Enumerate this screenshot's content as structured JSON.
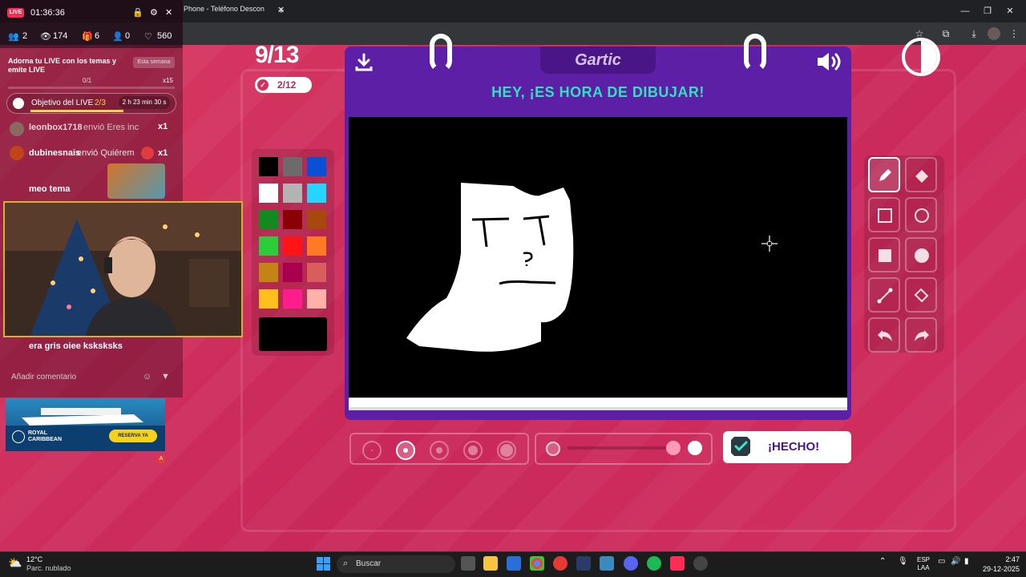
{
  "browser": {
    "tab_title": "Phone - Teléfono Descon",
    "tab_close": "✕",
    "new_tab": "+",
    "window_controls": {
      "minimize": "—",
      "maximize": "❐",
      "close": "✕"
    }
  },
  "game": {
    "round": "9/13",
    "correct_count": "2/12",
    "logo": "Gartic",
    "heading": "HEY, ¡ES HORA DE DIBUJAR!",
    "done_label": "¡HECHO!",
    "palette": [
      "#000000",
      "#6b6b6b",
      "#0a4fd8",
      "#ffffff",
      "#b3b3b3",
      "#25d4ff",
      "#118a1f",
      "#8a0005",
      "#a8480e",
      "#2dcc3a",
      "#ff1414",
      "#ff7a23",
      "#c48317",
      "#a8004f",
      "#d95d5d",
      "#ffc01c",
      "#ff1d8e",
      "#ffb0a8"
    ],
    "selected_color": "#000000",
    "selected_tool": "pencil",
    "brush_size_selected": 2,
    "opacity_percent": 100
  },
  "live": {
    "badge": "LIVE",
    "timer": "01:36:36",
    "stats": {
      "viewers_group": "2",
      "views": "174",
      "gifts": "6",
      "users": "0",
      "likes": "560"
    },
    "promo_title": "Adorna tu LIVE con los temas y emite LIVE",
    "promo_tag": "Esta semana",
    "promo_progress": "0/1",
    "promo_count": "x15",
    "goal_label": "Objetivo del LIVE",
    "goal_progress": "2/3",
    "goal_time": "2 h 23 min 30 s",
    "gifts_feed": [
      {
        "name": "leonbox1718",
        "text": "envió Eres inc",
        "count": "x1"
      },
      {
        "name": "dubinesnais",
        "text": "envió Quiérem",
        "count": "x1"
      }
    ],
    "chat": [
      {
        "text": "meo tema"
      },
      {
        "text": "era gris oiee ksksksks"
      }
    ],
    "comment_placeholder": "Añadir comentario",
    "ad_brand": "ROYAL CARIBBEAN",
    "ad_button": "RESERVA YA"
  },
  "taskbar": {
    "weather_temp": "12°C",
    "weather_desc": "Parc. nublado",
    "search_label": "Buscar",
    "lang": "ESP\nLAA",
    "time": "2:47",
    "date": "29-12-2025"
  }
}
